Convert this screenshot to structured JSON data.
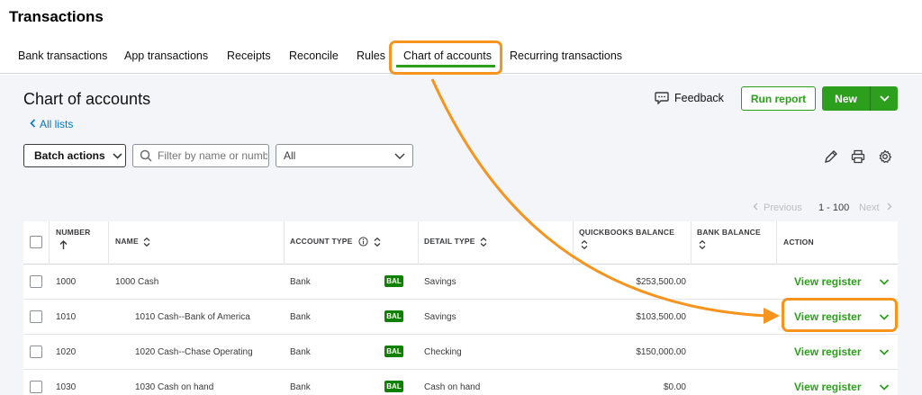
{
  "app": {
    "title": "Transactions"
  },
  "tabs": [
    {
      "label": "Bank transactions"
    },
    {
      "label": "App transactions"
    },
    {
      "label": "Receipts"
    },
    {
      "label": "Reconcile"
    },
    {
      "label": "Rules"
    },
    {
      "label": "Chart of accounts",
      "active": true
    },
    {
      "label": "Recurring transactions"
    }
  ],
  "page": {
    "title": "Chart of accounts",
    "back_link": "All lists",
    "feedback_label": "Feedback",
    "run_report_label": "Run report",
    "new_label": "New"
  },
  "toolbar": {
    "batch_actions_label": "Batch actions",
    "filter_placeholder": "Filter by name or number",
    "type_filter_value": "All",
    "icons": [
      "pencil-icon",
      "print-icon",
      "gear-icon"
    ]
  },
  "pagination": {
    "previous": "Previous",
    "range": "1 - 100",
    "next": "Next"
  },
  "table": {
    "headers": {
      "number": "NUMBER",
      "name": "NAME",
      "account_type": "ACCOUNT TYPE",
      "detail_type": "DETAIL TYPE",
      "qb_balance": "QUICKBOOKS BALANCE",
      "bank_balance": "BANK BALANCE",
      "action": "ACTION"
    },
    "badge_label": "BAL",
    "action_label": "View register",
    "rows": [
      {
        "number": "1000",
        "name": "1000 Cash",
        "account_type": "Bank",
        "detail_type": "Savings",
        "qb_balance": "$253,500.00",
        "bank_balance": ""
      },
      {
        "number": "1010",
        "name": "1010 Cash--Bank of America",
        "account_type": "Bank",
        "detail_type": "Savings",
        "qb_balance": "$103,500.00",
        "bank_balance": ""
      },
      {
        "number": "1020",
        "name": "1020 Cash--Chase Operating",
        "account_type": "Bank",
        "detail_type": "Checking",
        "qb_balance": "$150,000.00",
        "bank_balance": ""
      },
      {
        "number": "1030",
        "name": "1030 Cash on hand",
        "account_type": "Bank",
        "detail_type": "Cash on hand",
        "qb_balance": "$0.00",
        "bank_balance": ""
      }
    ]
  },
  "colors": {
    "accent_green": "#2ca01c",
    "badge_green": "#108000",
    "link_blue": "#0077c5",
    "annotation_orange": "#f7941d",
    "content_bg": "#f4f5f8"
  }
}
